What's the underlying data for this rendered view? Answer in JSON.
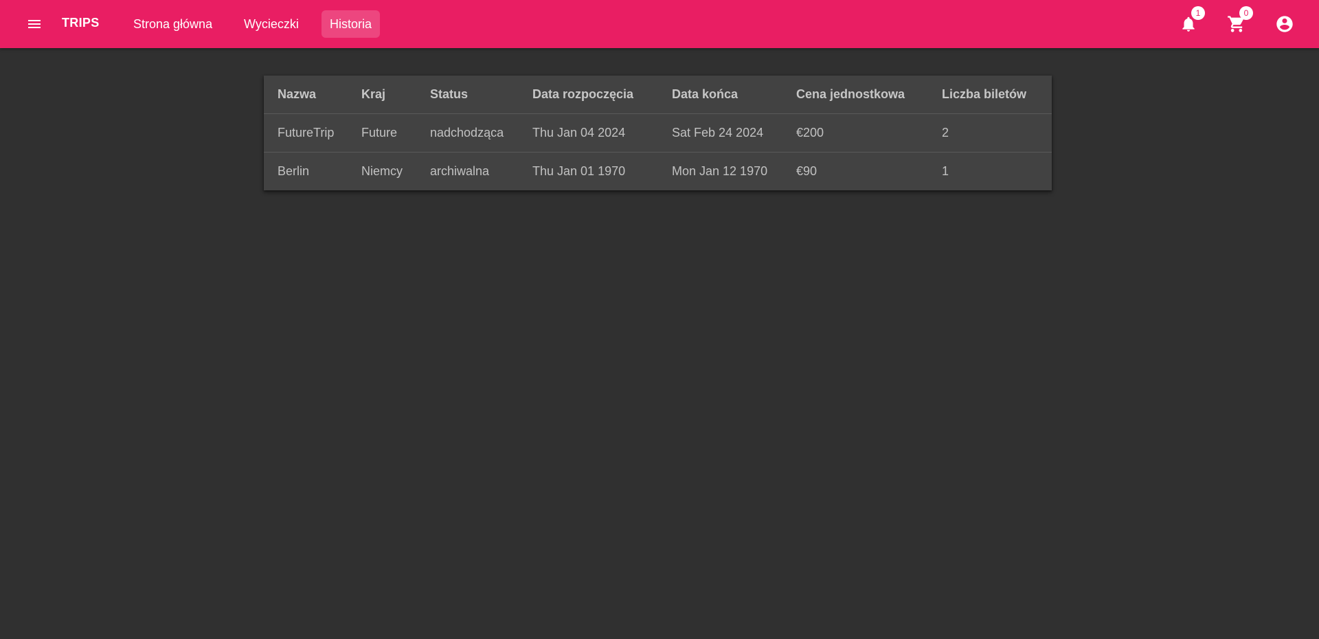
{
  "toolbar": {
    "brand": "TRIPS",
    "nav": [
      {
        "label": "Strona główna",
        "active": false
      },
      {
        "label": "Wycieczki",
        "active": false
      },
      {
        "label": "Historia",
        "active": true
      }
    ],
    "notifications_count": "1",
    "cart_count": "0",
    "icons": [
      "menu-icon",
      "bell-icon",
      "cart-icon",
      "account-circle-icon"
    ],
    "color": "#e91e63"
  },
  "history_table": {
    "headers": [
      "Nazwa",
      "Kraj",
      "Status",
      "Data rozpoczęcia",
      "Data końca",
      "Cena jednostkowa",
      "Liczba biletów"
    ],
    "rows": [
      [
        "FutureTrip",
        "Future",
        "nadchodząca",
        "Thu Jan 04 2024",
        "Sat Feb 24 2024",
        "€200",
        "2"
      ],
      [
        "Berlin",
        "Niemcy",
        "archiwalna",
        "Thu Jan 01 1970",
        "Mon Jan 12 1970",
        "€90",
        "1"
      ]
    ]
  }
}
